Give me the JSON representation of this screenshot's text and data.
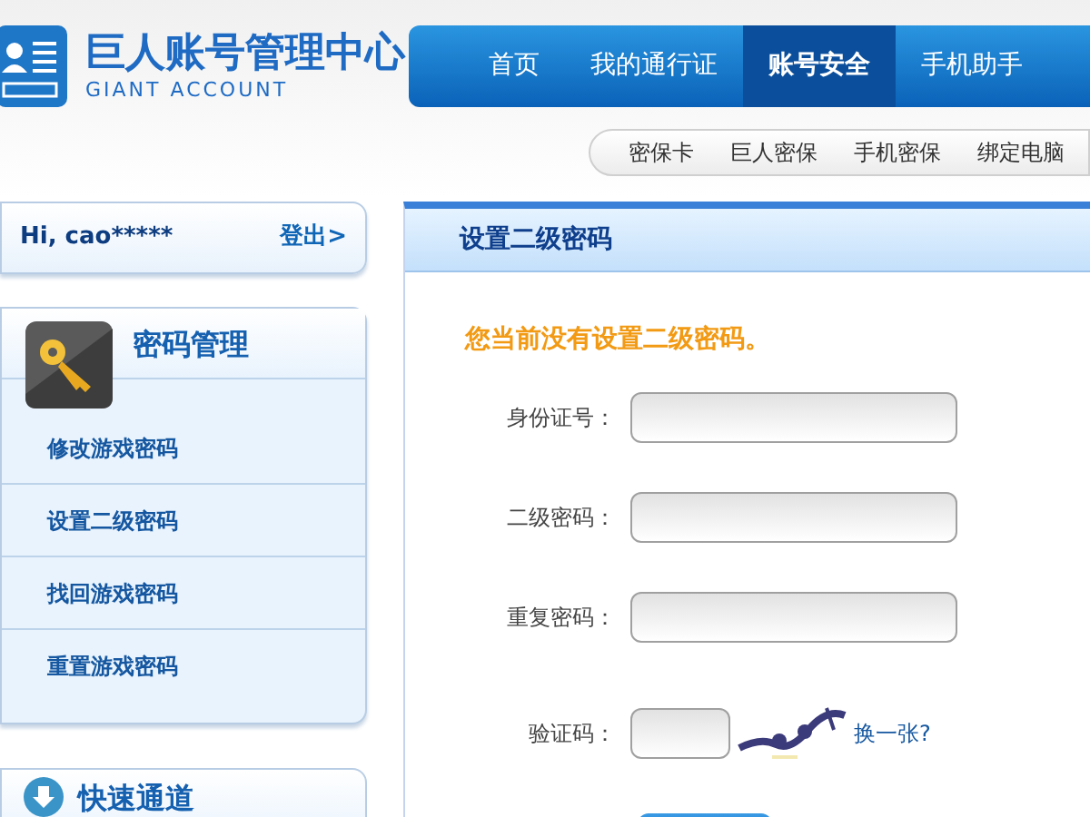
{
  "logo": {
    "title": "巨人账号管理中心",
    "subtitle": "GIANT ACCOUNT"
  },
  "nav": [
    {
      "label": "首页",
      "selected": false
    },
    {
      "label": "我的通行证",
      "selected": false
    },
    {
      "label": "账号安全",
      "selected": true
    },
    {
      "label": "手机助手",
      "selected": false
    }
  ],
  "subnav": [
    "密保卡",
    "巨人密保",
    "手机密保",
    "绑定电脑"
  ],
  "user": {
    "greeting": "Hi, cao*****",
    "logout": "登出>"
  },
  "sidebar": {
    "title": "密码管理",
    "items": [
      "修改游戏密码",
      "设置二级密码",
      "找回游戏密码",
      "重置游戏密码"
    ]
  },
  "quick": {
    "title": "快速通道"
  },
  "panel": {
    "title": "设置二级密码",
    "notice": "您当前没有设置二级密码。",
    "fields": [
      {
        "label": "身份证号：",
        "kind": "text"
      },
      {
        "label": "二级密码：",
        "kind": "text"
      },
      {
        "label": "重复密码：",
        "kind": "text"
      },
      {
        "label": "验证码：",
        "kind": "captcha",
        "refresh": "换一张?"
      }
    ]
  }
}
